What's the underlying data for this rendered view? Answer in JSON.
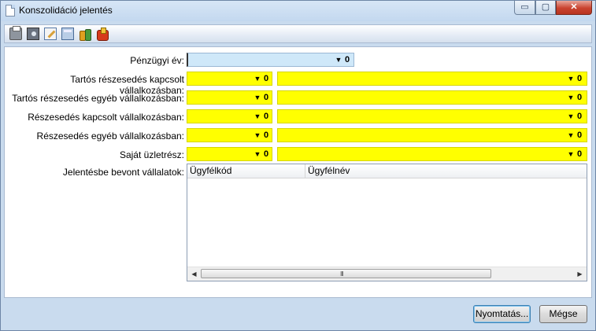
{
  "window": {
    "title": "Konszolidáció jelentés",
    "buttons": {
      "minimize": "▭",
      "maximize": "▢",
      "close": "✕"
    }
  },
  "toolbar": {
    "icons": [
      "printer-icon",
      "print-preview-icon",
      "edit-icon",
      "calculator-icon",
      "coins-icon",
      "exit-icon"
    ]
  },
  "form": {
    "fiscal_year": {
      "label": "Pénzügyi év:",
      "value": ""
    },
    "rows": [
      {
        "label": "Tartós részesedés kapcsolt vállalkozásban:",
        "left_value": "",
        "right_value": ""
      },
      {
        "label": "Tartós részesedés egyéb vállalkozásban:",
        "left_value": "",
        "right_value": ""
      },
      {
        "label": "Részesedés kapcsolt vállalkozásban:",
        "left_value": "",
        "right_value": ""
      },
      {
        "label": "Részesedés egyéb vállalkozásban:",
        "left_value": "",
        "right_value": ""
      },
      {
        "label": "Saját üzletrész:",
        "left_value": "",
        "right_value": ""
      }
    ],
    "companies": {
      "label": "Jelentésbe bevont vállalatok:",
      "columns": [
        "Ügyfélkód",
        "Ügyfélnév"
      ],
      "rows": []
    }
  },
  "glyphs": {
    "dropdown": "▼",
    "clip": "0",
    "scroll_left": "◀",
    "scroll_right": "▶",
    "grip": "III"
  },
  "footer": {
    "print_label": "Nyomtatás...",
    "cancel_label": "Mégse"
  },
  "colors": {
    "required": "#ffff00",
    "selected": "#cfe8f9",
    "frame": "#c9dbee"
  }
}
